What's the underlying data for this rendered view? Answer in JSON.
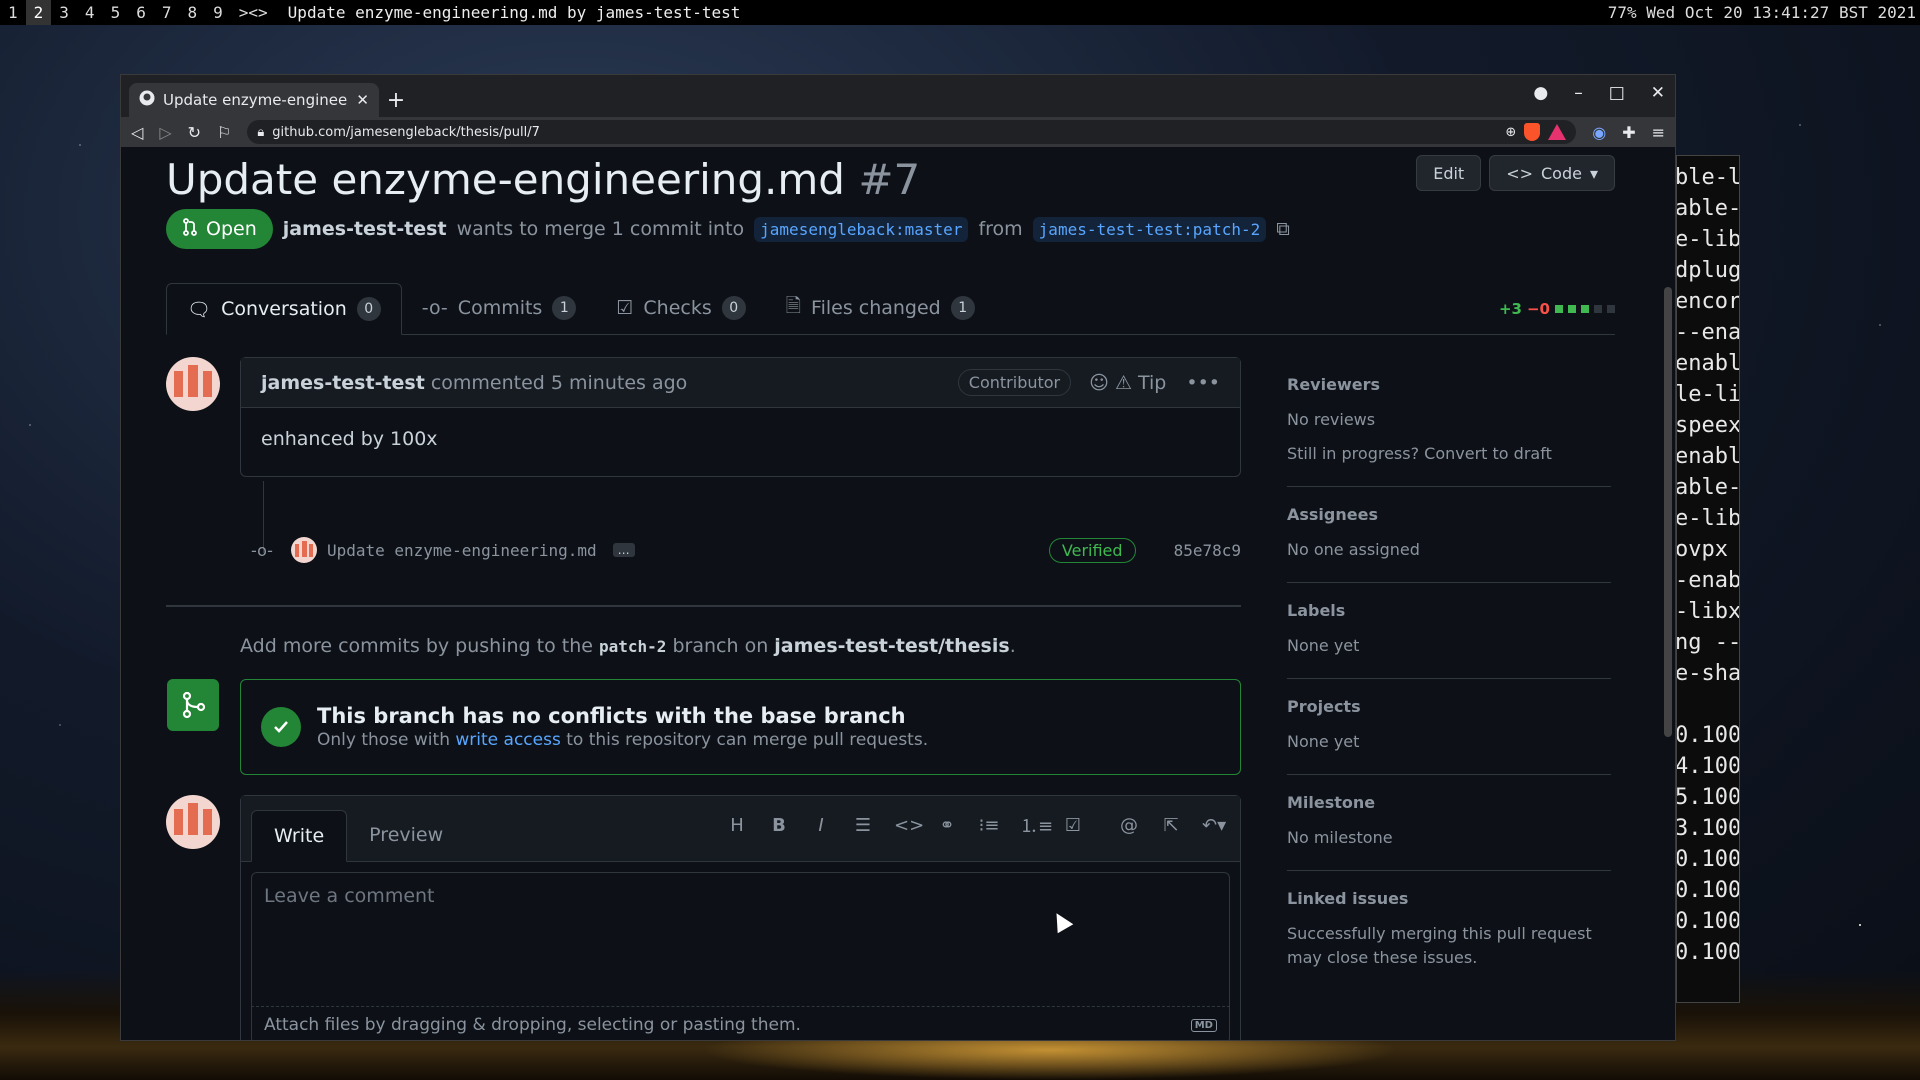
{
  "topbar": {
    "workspaces": [
      "1",
      "2",
      "3",
      "4",
      "5",
      "6",
      "7",
      "8",
      "9",
      "><>"
    ],
    "active_workspace": "2",
    "window_title": "Update enzyme-engineering.md by james-test-test",
    "status": "77% Wed Oct 20 13:41:27 BST 2021"
  },
  "terminal": {
    "lines": [
      "ble-l",
      "able-",
      "e-lib",
      "dplug",
      "encor",
      "--ena",
      "enabl",
      "le-li",
      "speex",
      "enabl",
      "able-",
      "e-lib",
      "ovpx",
      "-enab",
      "-libx",
      "ng --",
      "e-sha",
      "",
      "0.100",
      "4.100",
      "5.100",
      "3.100",
      "0.100",
      "0.100",
      "0.100",
      "0.100"
    ]
  },
  "browser": {
    "tab_title": "Update enzyme-engineerin",
    "url": "github.com/jamesengleback/thesis/pull/7",
    "icons": [
      "back-icon",
      "forward-icon",
      "reload-icon",
      "bookmark-icon",
      "lock-icon",
      "zoom-icon",
      "brave-shield-icon",
      "bat-rewards-icon",
      "extension-icon",
      "puzzle-icon",
      "menu-icon"
    ]
  },
  "pr": {
    "title": "Update enzyme-engineering.md",
    "number": "#7",
    "edit_label": "Edit",
    "code_label": "Code",
    "state": "Open",
    "author": "james-test-test",
    "merge_text_1": "wants to merge 1 commit into",
    "base_branch": "jamesengleback:master",
    "from_text": "from",
    "head_branch": "james-test-test:patch-2"
  },
  "tabs": [
    {
      "label": "Conversation",
      "count": "0"
    },
    {
      "label": "Commits",
      "count": "1"
    },
    {
      "label": "Checks",
      "count": "0"
    },
    {
      "label": "Files changed",
      "count": "1"
    }
  ],
  "diffstat": {
    "additions": "+3",
    "deletions": "−0"
  },
  "comment": {
    "author": "james-test-test",
    "action": "commented 5 minutes ago",
    "role": "Contributor",
    "tip": "Tip",
    "body": "enhanced by 100x"
  },
  "commit": {
    "message": "Update enzyme-engineering.md",
    "ellipsis": "…",
    "verified": "Verified",
    "sha": "85e78c9"
  },
  "push_note": {
    "prefix": "Add more commits by pushing to the",
    "branch": "patch-2",
    "middle": "branch on",
    "repo": "james-test-test/thesis",
    "suffix": "."
  },
  "merge": {
    "title": "This branch has no conflicts with the base branch",
    "sub_prefix": "Only those with",
    "sub_link": "write access",
    "sub_suffix": "to this repository can merge pull requests."
  },
  "editor": {
    "write_tab": "Write",
    "preview_tab": "Preview",
    "placeholder": "Leave a comment",
    "attach": "Attach files by dragging & dropping, selecting or pasting them.",
    "md": "MD"
  },
  "sidebar": {
    "reviewers": {
      "title": "Reviewers",
      "value": "No reviews",
      "extra": "Still in progress? Convert to draft"
    },
    "assignees": {
      "title": "Assignees",
      "value": "No one assigned"
    },
    "labels": {
      "title": "Labels",
      "value": "None yet"
    },
    "projects": {
      "title": "Projects",
      "value": "None yet"
    },
    "milestone": {
      "title": "Milestone",
      "value": "No milestone"
    },
    "linked": {
      "title": "Linked issues",
      "value": "Successfully merging this pull request may close these issues."
    }
  },
  "colors": {
    "accent_green": "#238636",
    "link_blue": "#58a6ff",
    "bg": "#0d1117"
  }
}
